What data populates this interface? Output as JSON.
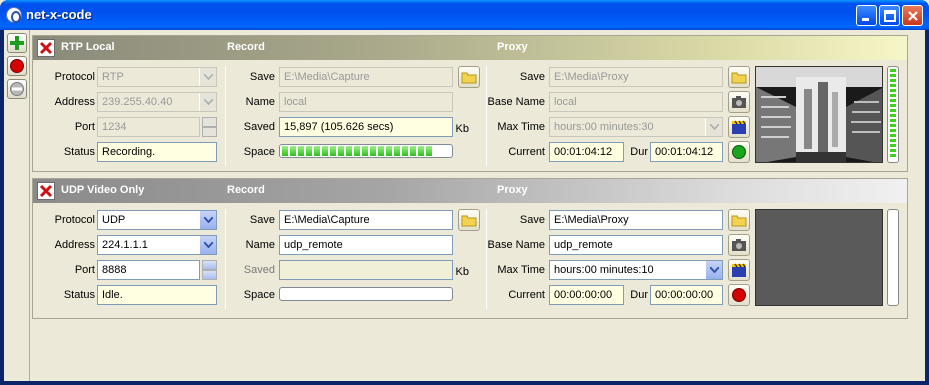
{
  "window": {
    "title": "net-x-code"
  },
  "sidebar": {
    "add_tooltip": "",
    "record_tooltip": "",
    "stop_tooltip": ""
  },
  "panels": [
    {
      "name": "RTP Local",
      "section_record": "Record",
      "section_proxy": "Proxy",
      "labels": {
        "protocol": "Protocol",
        "address": "Address",
        "port": "Port",
        "status": "Status",
        "save": "Save",
        "name": "Name",
        "saved": "Saved",
        "space": "Space",
        "p_save": "Save",
        "base_name": "Base Name",
        "max_time": "Max Time",
        "current": "Current",
        "dur": "Dur",
        "kb": "Kb"
      },
      "protocol": "RTP",
      "address": "239.255.40.40",
      "port": "1234",
      "status": "Recording.",
      "record_save": "E:\\Media\\Capture",
      "record_name": "local",
      "saved": "15,897 (105.626 secs)",
      "space_fraction": 0.95,
      "proxy_save": "E:\\Media\\Proxy",
      "proxy_base_name": "local",
      "max_time": "hours:00 minutes:30",
      "current": "00:01:04:12",
      "dur": "00:01:04:12",
      "state": "recording"
    },
    {
      "name": "UDP Video Only",
      "section_record": "Record",
      "section_proxy": "Proxy",
      "labels": {
        "protocol": "Protocol",
        "address": "Address",
        "port": "Port",
        "status": "Status",
        "save": "Save",
        "name": "Name",
        "saved": "Saved",
        "space": "Space",
        "p_save": "Save",
        "base_name": "Base Name",
        "max_time": "Max Time",
        "current": "Current",
        "dur": "Dur",
        "kb": "Kb"
      },
      "protocol": "UDP",
      "address": "224.1.1.1",
      "port": "8888",
      "status": "Idle.",
      "record_save": "E:\\Media\\Capture",
      "record_name": "udp_remote",
      "saved": "",
      "space_fraction": 0,
      "proxy_save": "E:\\Media\\Proxy",
      "proxy_base_name": "udp_remote",
      "max_time": "hours:00 minutes:10",
      "current": "00:00:00:00",
      "dur": "00:00:00:00",
      "state": "idle"
    }
  ],
  "colors": {
    "titlebar": "#0054e3",
    "status_bg": "#ffffe1",
    "meter_green": "#3ed120",
    "record_red": "#d40000",
    "go_green": "#1aa51a"
  }
}
